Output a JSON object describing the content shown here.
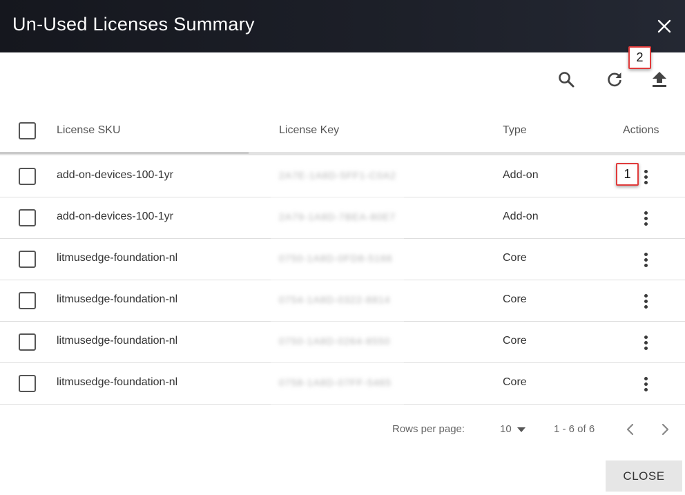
{
  "dialog": {
    "title": "Un-Used Licenses Summary"
  },
  "toolbar": {
    "icons": [
      "search-icon",
      "refresh-icon",
      "upload-icon"
    ]
  },
  "callouts": {
    "first": "1",
    "second": "2"
  },
  "table": {
    "columns": {
      "sku": "License SKU",
      "key": "License Key",
      "type": "Type",
      "actions": "Actions"
    },
    "rows": [
      {
        "sku": "add-on-devices-100-1yr",
        "key": "2A7E-1A8D-5FF1-C0A2",
        "type": "Add-on"
      },
      {
        "sku": "add-on-devices-100-1yr",
        "key": "2A79-1A8D-7BEA-80E7",
        "type": "Add-on"
      },
      {
        "sku": "litmusedge-foundation-nl",
        "key": "0750-1A8D-0FD8-5166",
        "type": "Core"
      },
      {
        "sku": "litmusedge-foundation-nl",
        "key": "0754-1A8D-0322-8814",
        "type": "Core"
      },
      {
        "sku": "litmusedge-foundation-nl",
        "key": "0750-1A8D-0264-8550",
        "type": "Core"
      },
      {
        "sku": "litmusedge-foundation-nl",
        "key": "0758-1A8D-07FF-5465",
        "type": "Core"
      }
    ]
  },
  "footer": {
    "rows_per_page_label": "Rows per page:",
    "rows_per_page_value": "10",
    "page_range": "1 - 6 of 6",
    "close_label": "CLOSE"
  },
  "colors": {
    "title_bar": "#1b1e26",
    "callout_border": "#e03b3b",
    "close_button_bg": "#e6e6e6"
  }
}
